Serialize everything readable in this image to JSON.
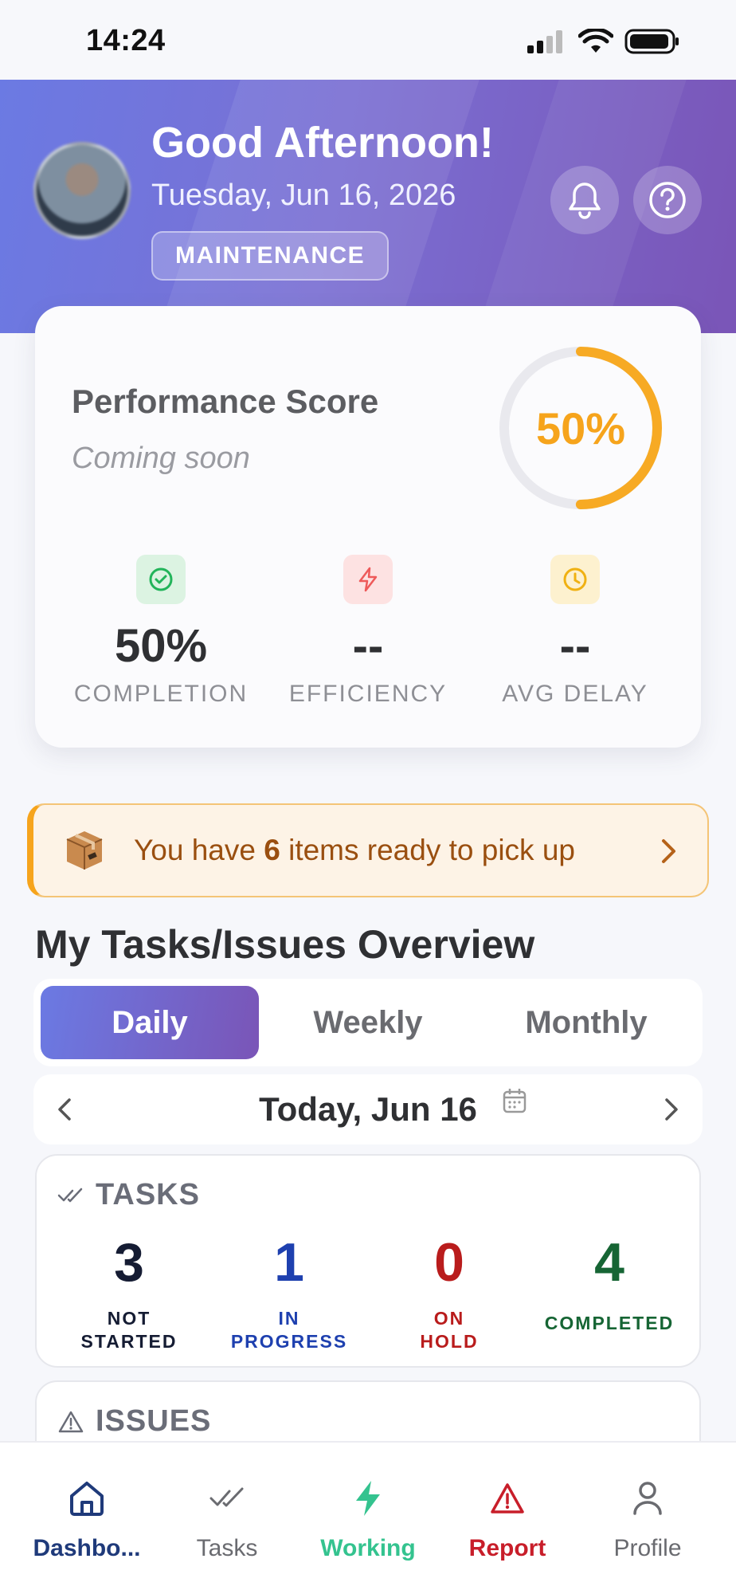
{
  "status_bar": {
    "time": "14:24"
  },
  "header": {
    "greeting": "Good Afternoon!",
    "date": "Tuesday, Jun 16, 2026",
    "role_badge": "MAINTENANCE"
  },
  "performance": {
    "title": "Performance Score",
    "subtitle": "Coming soon",
    "score_label": "50%",
    "score_fraction": 0.5,
    "stats": [
      {
        "value": "50%",
        "label": "COMPLETION",
        "icon": "check-circle-icon"
      },
      {
        "value": "--",
        "label": "EFFICIENCY",
        "icon": "lightning-icon"
      },
      {
        "value": "--",
        "label": "AVG DELAY",
        "icon": "clock-icon"
      }
    ]
  },
  "pickup_banner": {
    "prefix": "You have ",
    "count": "6",
    "suffix": " items ready to pick up"
  },
  "overview": {
    "title": "My Tasks/Issues Overview",
    "tabs": [
      "Daily",
      "Weekly",
      "Monthly"
    ],
    "active_tab": "Daily",
    "date_label": "Today, Jun 16"
  },
  "tasks": {
    "heading": "TASKS",
    "stats": [
      {
        "value": "3",
        "label_1": "NOT",
        "label_2": "STARTED",
        "color": "#151c33"
      },
      {
        "value": "1",
        "label_1": "IN",
        "label_2": "PROGRESS",
        "color": "#1e40af"
      },
      {
        "value": "0",
        "label_1": "ON",
        "label_2": "HOLD",
        "color": "#b91c1c"
      },
      {
        "value": "4",
        "label_1": "COMPLETED",
        "label_2": "",
        "color": "#166534"
      }
    ]
  },
  "issues": {
    "heading": "ISSUES"
  },
  "bottom_nav": [
    {
      "label": "Dashbo...",
      "icon": "home-icon",
      "color": "#1f3a7a"
    },
    {
      "label": "Tasks",
      "icon": "double-check-icon",
      "color": "#6a6b70"
    },
    {
      "label": "Working",
      "icon": "lightning-icon",
      "color": "#34c38f"
    },
    {
      "label": "Report",
      "icon": "warning-icon",
      "color": "#c81e2a"
    },
    {
      "label": "Profile",
      "icon": "person-icon",
      "color": "#6a6b70"
    }
  ],
  "colors": {
    "accent_gradient_start": "#6b7ae3",
    "accent_gradient_end": "#7a55b7",
    "score_orange": "#f6a41c"
  }
}
